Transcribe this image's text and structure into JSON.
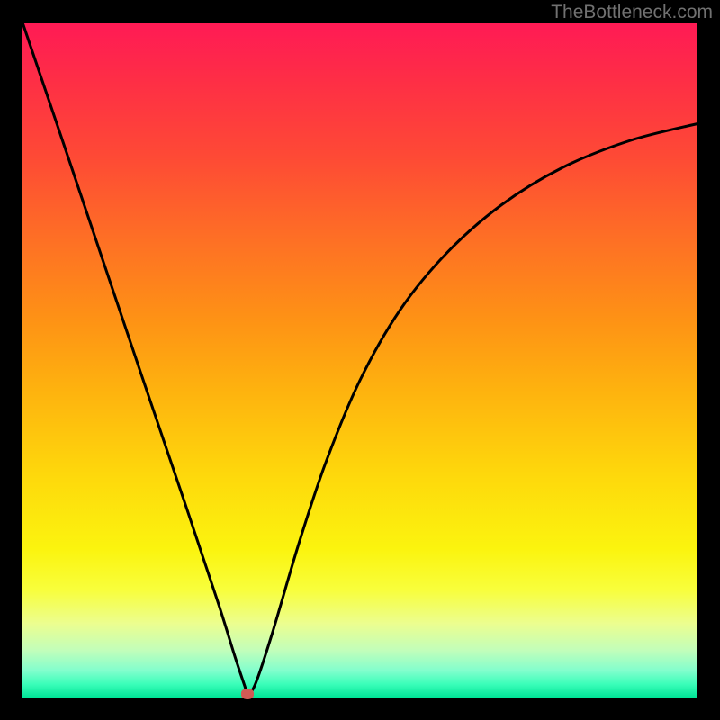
{
  "watermark": "TheBottleneck.com",
  "dot": {
    "x_frac": 0.332,
    "y_frac": 0.994
  },
  "chart_data": {
    "type": "line",
    "title": "",
    "xlabel": "",
    "ylabel": "",
    "xlim": [
      0,
      1
    ],
    "ylim": [
      0,
      1
    ],
    "note": "Axes unlabeled; values are normalized fractions of the plot area. y=1 at top, y=0 at bottom. Curve shows a deep V-shaped dip near x≈0.33 with a steep left leg and a longer, bowed right leg rising toward the upper right.",
    "series": [
      {
        "name": "curve",
        "x": [
          0.0,
          0.06,
          0.12,
          0.18,
          0.24,
          0.29,
          0.315,
          0.33,
          0.333,
          0.345,
          0.37,
          0.41,
          0.45,
          0.5,
          0.56,
          0.63,
          0.71,
          0.8,
          0.9,
          1.0
        ],
        "y": [
          1.0,
          0.823,
          0.645,
          0.467,
          0.29,
          0.14,
          0.06,
          0.015,
          0.005,
          0.02,
          0.095,
          0.23,
          0.35,
          0.47,
          0.575,
          0.66,
          0.73,
          0.785,
          0.825,
          0.85
        ]
      }
    ],
    "marker": {
      "x": 0.333,
      "y": 0.006,
      "color": "#d15a55"
    },
    "gradient_stops": [
      {
        "pos": 0.0,
        "color": "#ff1a55"
      },
      {
        "pos": 0.2,
        "color": "#fe4a35"
      },
      {
        "pos": 0.44,
        "color": "#fe9215"
      },
      {
        "pos": 0.67,
        "color": "#fed80c"
      },
      {
        "pos": 0.84,
        "color": "#f8fe3b"
      },
      {
        "pos": 0.96,
        "color": "#82fecd"
      },
      {
        "pos": 1.0,
        "color": "#00e597"
      }
    ]
  }
}
